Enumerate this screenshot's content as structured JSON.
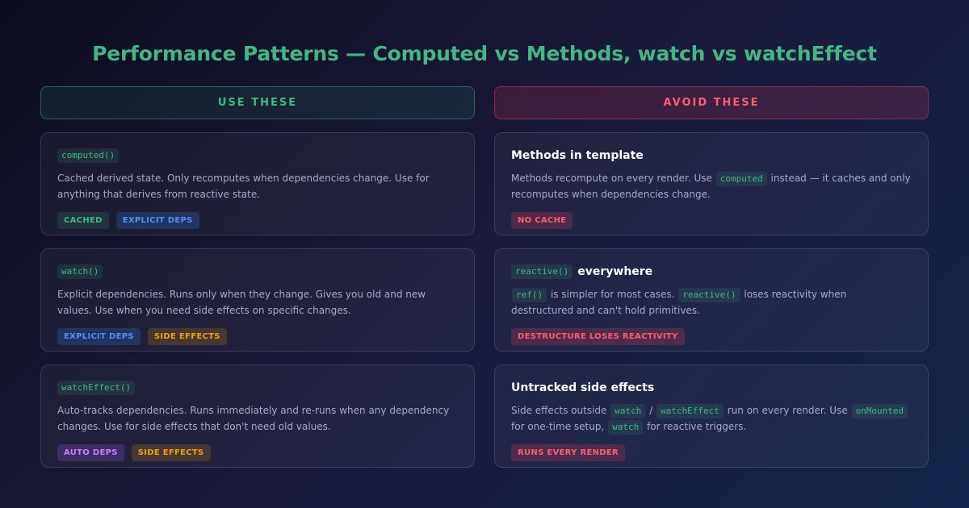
{
  "title": "Performance Patterns — Computed vs Methods, watch vs watchEffect",
  "colors": {
    "accent": "#41b883",
    "danger": "#fb5f72",
    "blue": "#4f8ff7",
    "orange": "#f59e0b",
    "purple": "#c084fc"
  },
  "left": {
    "header": "USE THESE",
    "cards": [
      {
        "code": "computed()",
        "desc": "Cached derived state. Only recomputes when dependencies change. Use for anything that derives from reactive state.",
        "badges": [
          "CACHED",
          "EXPLICIT DEPS"
        ]
      },
      {
        "code": "watch()",
        "desc": "Explicit dependencies. Runs only when they change. Gives you old and new values. Use when you need side effects on specific changes.",
        "badges": [
          "EXPLICIT DEPS",
          "SIDE EFFECTS"
        ]
      },
      {
        "code": "watchEffect()",
        "desc": "Auto-tracks dependencies. Runs immediately and re-runs when any dependency changes. Use for side effects that don't need old values.",
        "badges": [
          "AUTO DEPS",
          "SIDE EFFECTS"
        ]
      }
    ]
  },
  "right": {
    "header": "AVOID THESE",
    "cards": [
      {
        "title": "Methods in template",
        "desc_a": "Methods recompute on every render. Use",
        "desc_code1": "computed",
        "desc_b": "instead — it caches and only recomputes when dependencies change.",
        "badge": "NO CACHE"
      },
      {
        "title_code": "reactive()",
        "title": "everywhere",
        "desc_code1": "ref()",
        "desc_a": "is simpler for most cases.",
        "desc_code2": "reactive()",
        "desc_b": "loses reactivity when destructured and can't hold primitives.",
        "badge": "DESTRUCTURE LOSES REACTIVITY"
      },
      {
        "title": "Untracked side effects",
        "desc_a": "Side effects outside",
        "desc_code1": "watch",
        "desc_sep": "/",
        "desc_code2": "watchEffect",
        "desc_b": "run on every render. Use",
        "desc_code3": "onMounted",
        "desc_c": "for one-time setup,",
        "desc_code4": "watch",
        "desc_d": "for reactive triggers.",
        "badge": "RUNS EVERY RENDER"
      }
    ]
  }
}
